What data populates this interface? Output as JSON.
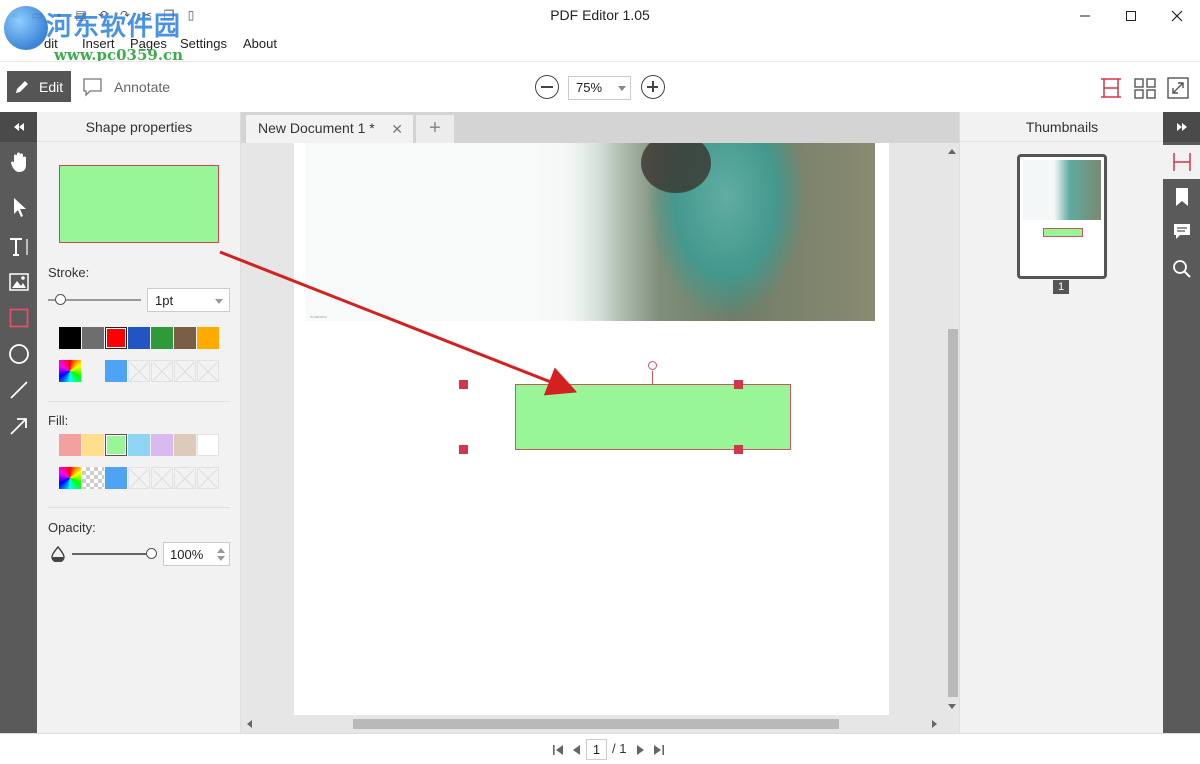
{
  "app": {
    "title": "PDF Editor 1.05"
  },
  "watermark": {
    "text": "河东软件园",
    "url": "www.pc0359.cn"
  },
  "menu": {
    "items": [
      "Edit",
      "Insert",
      "Pages",
      "Settings",
      "About"
    ],
    "first_visible": "dit"
  },
  "toolbar": {
    "edit_label": "Edit",
    "annotate_label": "Annotate",
    "zoom_value": "75%"
  },
  "left_tools": [
    "collapse-left-icon",
    "hand-icon",
    "pointer-icon",
    "text-icon",
    "image-icon",
    "rectangle-icon",
    "ellipse-icon",
    "line-icon",
    "arrow-icon"
  ],
  "props": {
    "title": "Shape properties",
    "stroke_label": "Stroke:",
    "stroke_width": "1pt",
    "fill_label": "Fill:",
    "opacity_label": "Opacity:",
    "opacity_value": "100%",
    "stroke_colors": [
      "#000000",
      "#6e6e6e",
      "#ff0000",
      "#2255c4",
      "#2f9a3a",
      "#7a5e46",
      "#ffab00"
    ],
    "fill_colors": [
      "#f4a0a0",
      "#ffdf8c",
      "#98f598",
      "#8fd4f5",
      "#dab8f0",
      "#dccbbb",
      "#ffffff"
    ],
    "custom_color": "#4fa3f5",
    "shape_fill": "#98f598",
    "shape_stroke": "#c94a4a"
  },
  "document": {
    "tab_title": "New Document 1 *",
    "photo_caption": "ПОЛЕМИКА"
  },
  "thumbnails": {
    "title": "Thumbnails",
    "page_number": "1"
  },
  "right_tools": [
    "collapse-right-icon",
    "page-layout-icon",
    "bookmark-icon",
    "comment-icon",
    "search-icon"
  ],
  "pager": {
    "current": "1",
    "total": "/ 1"
  },
  "colors": {
    "accent": "#d2364a",
    "rail": "#5a5a5a",
    "panel": "#f2f2f2"
  }
}
